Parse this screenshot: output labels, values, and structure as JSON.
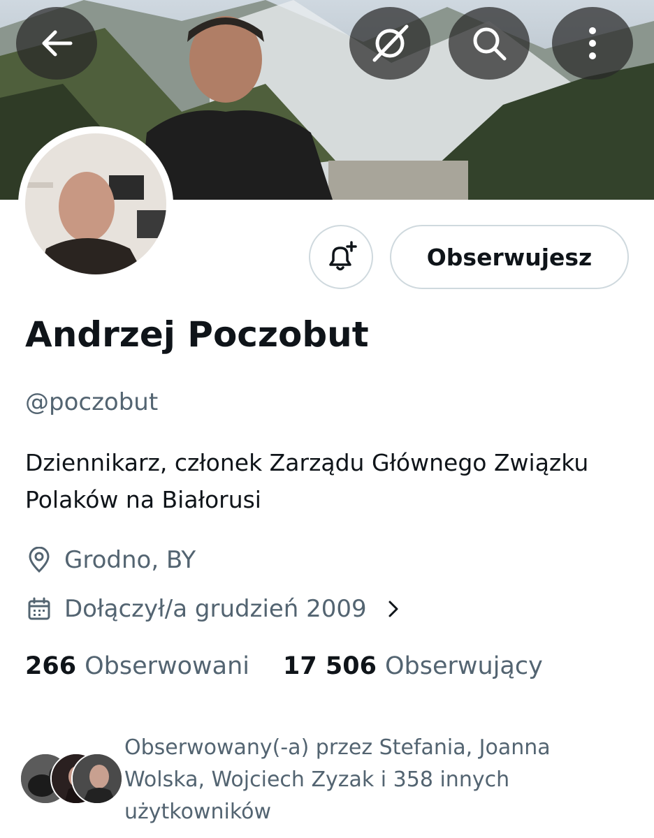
{
  "header": {
    "back_icon": "arrow-left-icon",
    "grok_icon": "grok-icon",
    "search_icon": "search-icon",
    "more_icon": "more-vertical-icon"
  },
  "profile": {
    "display_name": "Andrzej Poczobut",
    "handle": "@poczobut",
    "bio": "Dziennikarz, członek Zarządu Głównego Związku Polaków na Białorusi",
    "location": "Grodno, BY",
    "joined": "Dołączył/a grudzień 2009",
    "following_count": "266",
    "following_label": "Obserwowani",
    "followers_count": "17 506",
    "followers_label": "Obserwujący",
    "followed_by_text": "Obserwowany(-a) przez Stefania, Joanna Wolska, Wojciech Zyzak i 358 innych użytkowników"
  },
  "actions": {
    "follow_label": "Obserwujesz",
    "notify_icon": "bell-plus-icon"
  },
  "colors": {
    "text_primary": "#0f1419",
    "text_secondary": "#536471",
    "border": "#cfd9de"
  }
}
